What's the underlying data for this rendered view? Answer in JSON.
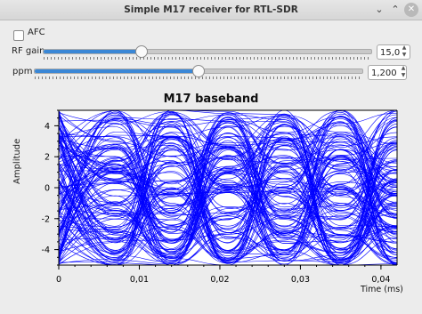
{
  "window": {
    "title": "Simple M17 receiver for RTL-SDR",
    "buttons": {
      "minimize": "⌄",
      "maximize": "⌃",
      "close": "✕"
    }
  },
  "controls": {
    "afc": {
      "label": "AFC",
      "checked": false
    },
    "rf_gain": {
      "label": "RF gain",
      "value": "15,0",
      "slider_fraction": 0.3
    },
    "ppm": {
      "label": "ppm",
      "value": "1,200",
      "slider_fraction": 0.5
    }
  },
  "chart_data": {
    "type": "line",
    "title": "M17 baseband",
    "xlabel": "Time (ms)",
    "ylabel": "Amplitude",
    "xlim": [
      0,
      0.042
    ],
    "ylim": [
      -5,
      5
    ],
    "x_ticks": [
      "0",
      "0,01",
      "0,02",
      "0,03",
      "0,04"
    ],
    "y_ticks": [
      "4",
      "2",
      "0",
      "-2",
      "-4"
    ],
    "line_color": "#0000ff",
    "description_values": "eye diagram of overlapping traces spanning approximately -5 to 5"
  }
}
